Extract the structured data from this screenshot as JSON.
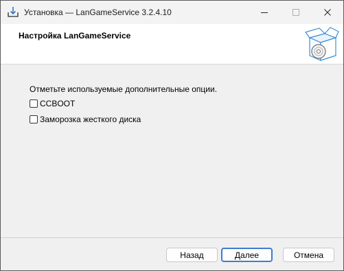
{
  "window": {
    "title": "Установка — LanGameService 3.2.4.10",
    "controls": {
      "minimize": "minimize-icon",
      "maximize": "maximize-icon",
      "close": "close-icon"
    }
  },
  "header": {
    "title": "Настройка LanGameService",
    "graphic": "installer-box-icon"
  },
  "content": {
    "instruction": "Отметьте используемые дополнительные опции.",
    "options": [
      {
        "label": "CCBOOT",
        "checked": false
      },
      {
        "label": "Заморозка жесткого диска",
        "checked": false
      }
    ]
  },
  "buttons": {
    "back": "Назад",
    "next": "Далее",
    "cancel": "Отмена"
  },
  "colors": {
    "accent": "#3d7bd0",
    "window_bg": "#f0f0f0",
    "header_bg": "#ffffff"
  }
}
